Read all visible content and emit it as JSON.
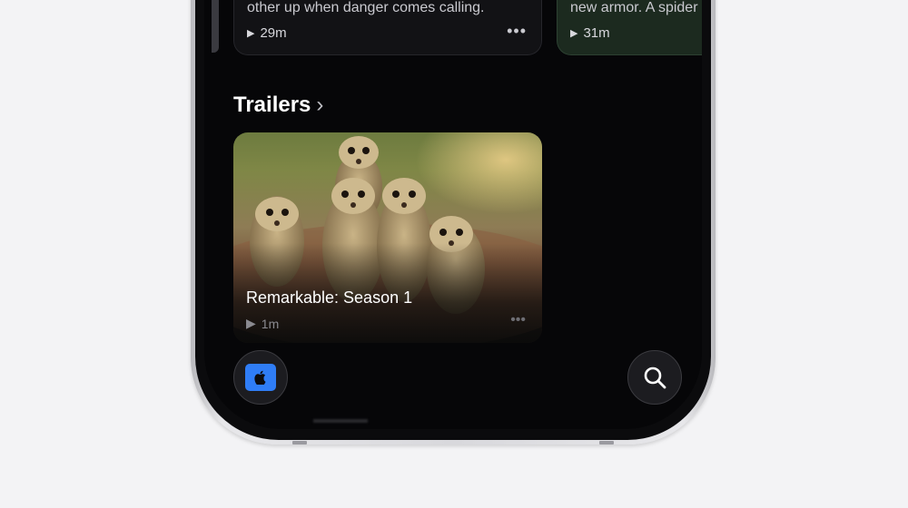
{
  "episodes": [
    {
      "description": "other up when danger comes calling.",
      "duration": "29m",
      "more": "•••"
    },
    {
      "description": "new armor. A spider",
      "duration": "31m"
    }
  ],
  "trailers": {
    "heading": "Trailers",
    "chevron": "›",
    "card": {
      "title": "Remarkable: Season 1",
      "duration": "1m",
      "more": "•••"
    }
  },
  "nav": {
    "home_icon": "apple-tv-icon",
    "search_icon": "search-icon",
    "home_icon_color": "#2f7df6"
  }
}
